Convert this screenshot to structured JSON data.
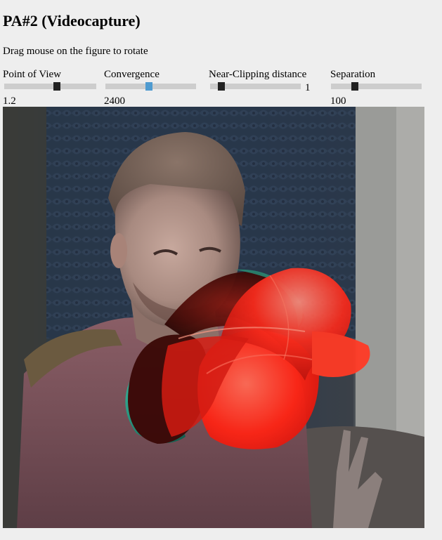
{
  "page": {
    "title": "PA#2 (Videocapture)",
    "instructions": "Drag mouse on the figure to rotate"
  },
  "controls": {
    "point_of_view": {
      "label": "Point of View",
      "value": "1.2",
      "position": 0.6
    },
    "convergence": {
      "label": "Convergence",
      "value": "2400",
      "position": 0.48
    },
    "near_clipping": {
      "label": "Near-Clipping distance",
      "value": "1",
      "position": 0.1
    },
    "separation": {
      "label": "Separation",
      "value": "100",
      "position": 0.2
    }
  },
  "viewport": {
    "description_colors": {
      "figure_red": "#ff2a1a",
      "figure_cyan": "#1fa58a"
    }
  }
}
